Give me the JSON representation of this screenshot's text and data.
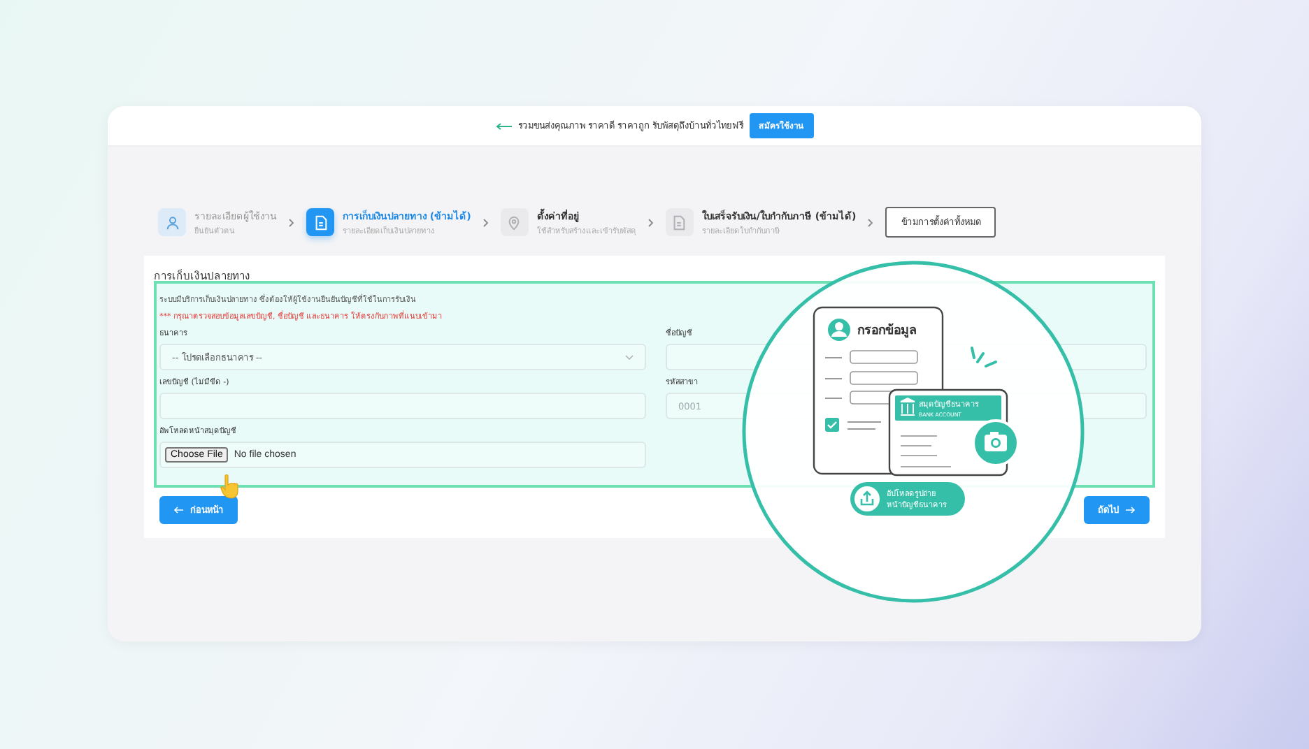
{
  "banner": {
    "text": "รวมขนส่งคุณภาพ ราคาดี ราคาถูก รับพัสดุถึงบ้านทั่วไทยฟรี",
    "button": "สมัครใช้งาน"
  },
  "steps": [
    {
      "kind": "user",
      "title": "รายละเอียดผู้ใช้งาน",
      "subtitle": "ยืนยันตัวตน",
      "completed": true,
      "selected": false
    },
    {
      "kind": "document",
      "title": "การเก็บเงินปลายทาง (ข้ามได้)",
      "subtitle": "รายละเอียดเก็บเงินปลายทาง",
      "completed": false,
      "selected": true
    },
    {
      "kind": "location",
      "title": "ตั้งค่าที่อยู่",
      "subtitle": "ใช้สำหรับสร้างและเข้ารับพัสดุ",
      "completed": false,
      "selected": false
    },
    {
      "kind": "document",
      "title": "ใบเสร็จรับเงิน/ใบกำกับภาษี (ข้ามได้)",
      "subtitle": "รายละเอียดใบกำกับภาษี",
      "completed": false,
      "selected": false
    }
  ],
  "skip_button": "ข้ามการตั้งค่าทั้งหมด",
  "form": {
    "title": "การเก็บเงินปลายทาง",
    "intro": "ระบบมีบริการเก็บเงินปลายทาง ซึ่งต้องให้ผู้ใช้งานยืนยันบัญชีที่ใช้ในการรับเงิน",
    "warning": "*** กรุณาตรวจสอบข้อมูลเลขบัญชี, ชื่อบัญชี และธนาคาร ให้ตรงกับภาพที่แนบเข้ามา",
    "fields": [
      {
        "kind": "select",
        "label": "ธนาคาร",
        "value": "-- โปรดเลือกธนาคาร --"
      },
      {
        "kind": "text",
        "label": "ชื่อบัญชี"
      },
      {
        "kind": "text",
        "label": "เลขบัญชี (ไม่มีขีด -)"
      },
      {
        "kind": "text",
        "label": "รหัสสาขา",
        "placeholder": "0001"
      },
      {
        "kind": "file",
        "label": "อัพโหลดหน้าสมุดบัญชี",
        "button": "Choose File",
        "value": "No file chosen"
      }
    ]
  },
  "back_button": "ก่อนหน้า",
  "next_button": "ถัดไป",
  "callout": {
    "sheet_title": "กรอกข้อมูล",
    "book_title": "สมุดบัญชีธนาคาร",
    "book_subtitle": "BANK ACCOUNT",
    "upload_lines": [
      "อัปโหลดรูปถ่าย",
      "หน้าบัญชีธนาคาร"
    ]
  }
}
